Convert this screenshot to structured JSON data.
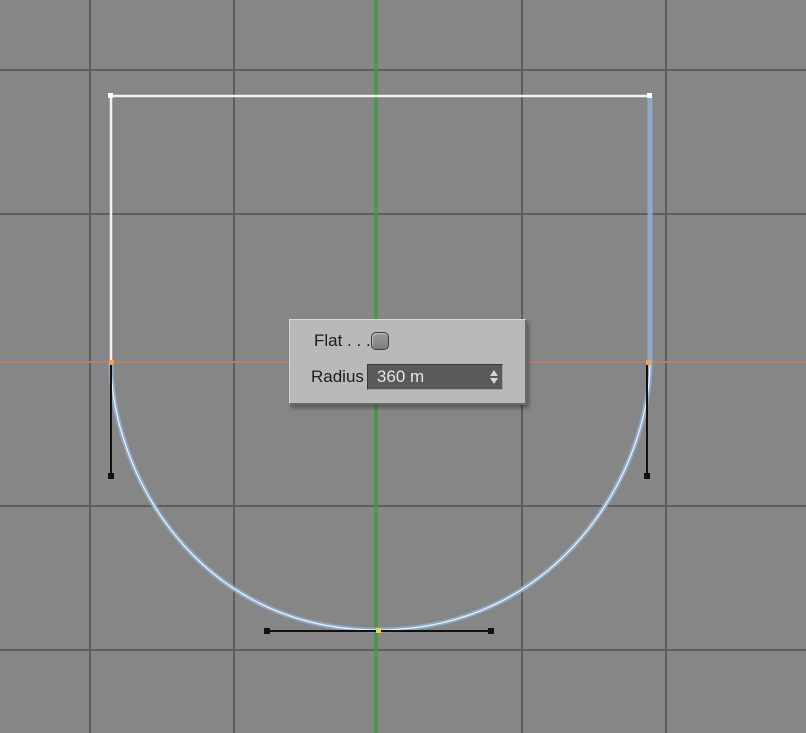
{
  "viewport": {
    "background": "#868686",
    "grid_color": "#5c5c5c",
    "axis_vertical_color": "#35a035",
    "axis_horizontal_color": "#b0806a"
  },
  "spline": {
    "path_color": "#ffffff",
    "highlight_color": "#8fb0d4",
    "handle_color": "#111111",
    "point_color": "#f0a050"
  },
  "panel": {
    "flat_label": "Flat . . .",
    "flat_checked": false,
    "radius_label": "Radius",
    "radius_value": "360 m",
    "spinner_icon": "up-down-arrows-icon"
  }
}
